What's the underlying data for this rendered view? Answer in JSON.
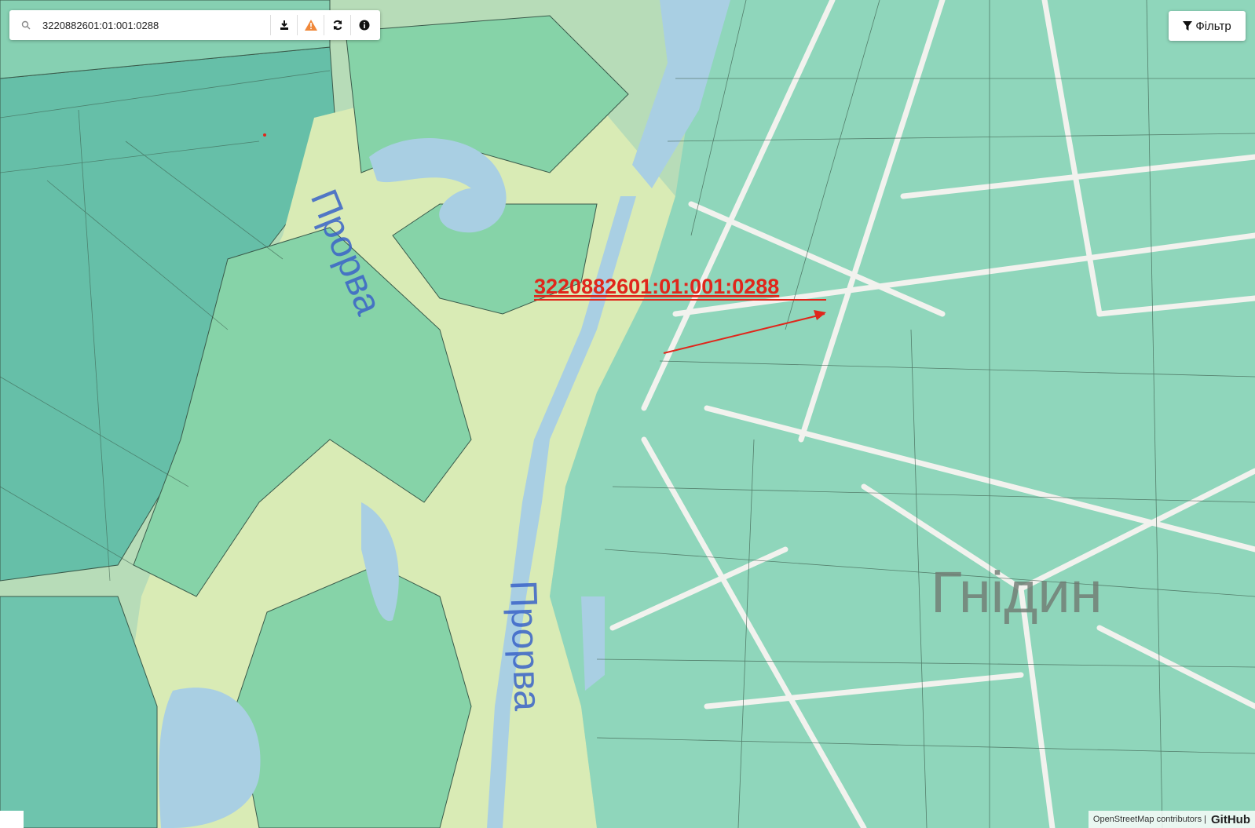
{
  "search": {
    "value": "3220882601:01:001:0288",
    "placeholder": ""
  },
  "toolbar": {
    "download_icon": "download-icon",
    "warning_icon": "warning-icon",
    "refresh_icon": "refresh-icon",
    "info_icon": "info-icon"
  },
  "filter": {
    "label": "Фільтр",
    "icon": "filter-icon"
  },
  "map": {
    "parcel_label": "3220882601:01:001:0288",
    "river_label_1": "Прорва",
    "river_label_2": "Прорва",
    "place_label": "Гнідин",
    "colors": {
      "base": "#b7dcb8",
      "meadow": "#d9ebb5",
      "parcel": "#7fd1ad",
      "parcel_stroke": "#3a5a4a",
      "water": "#a9cfe3",
      "road": "#f2f2ee",
      "label_red": "#e0261b",
      "label_blue": "#3a63c8"
    }
  },
  "attribution": {
    "osm": "OpenStreetMap contributors |",
    "github": "GitHub"
  }
}
